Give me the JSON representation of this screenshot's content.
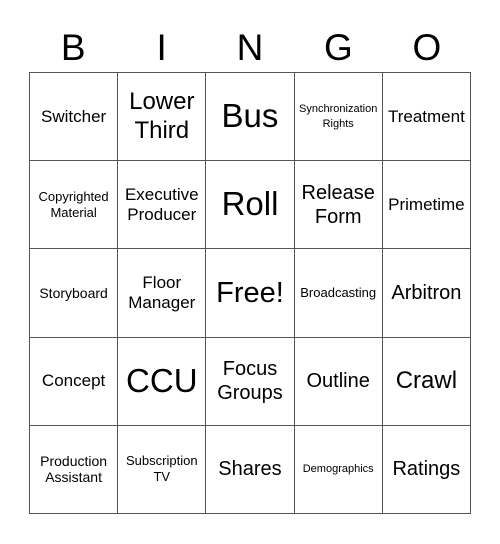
{
  "header": {
    "letters": [
      "B",
      "I",
      "N",
      "G",
      "O"
    ]
  },
  "cells": [
    [
      "Switcher",
      "Lower Third",
      "Bus",
      "Synchronization Rights",
      "Treatment"
    ],
    [
      "Copyrighted Material",
      "Executive Producer",
      "Roll",
      "Release Form",
      "Primetime"
    ],
    [
      "Storyboard",
      "Floor Manager",
      "Free!",
      "Broadcasting",
      "Arbitron"
    ],
    [
      "Concept",
      "CCU",
      "Focus Groups",
      "Outline",
      "Crawl"
    ],
    [
      "Production Assistant",
      "Subscription TV",
      "Shares",
      "Demographics",
      "Ratings"
    ]
  ]
}
